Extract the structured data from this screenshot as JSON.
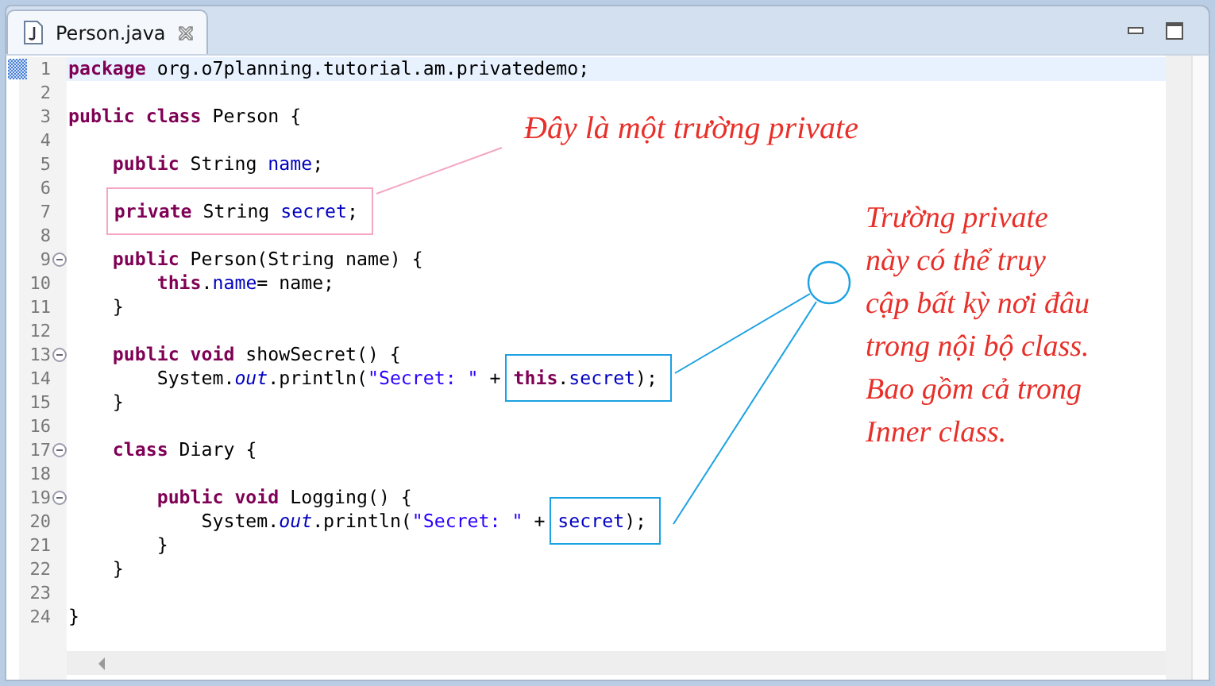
{
  "tab": {
    "title": "Person.java",
    "selected": true
  },
  "lines": [
    {
      "number": "1",
      "current": true,
      "foldable": false,
      "tokens": [
        {
          "kind": "keyword",
          "text": "package"
        },
        {
          "kind": "plain",
          "text": " org.o7planning.tutorial.am.privatedemo;"
        }
      ]
    },
    {
      "number": "2",
      "current": false,
      "foldable": false
    },
    {
      "number": "3",
      "current": false,
      "foldable": false,
      "tokens": [
        {
          "kind": "keyword",
          "text": "public"
        },
        {
          "kind": "keyword",
          "text": " class"
        },
        {
          "kind": "plain",
          "text": " Person {"
        }
      ]
    },
    {
      "number": "4",
      "current": false,
      "foldable": false
    },
    {
      "number": "5",
      "current": false,
      "foldable": false,
      "tokens": [
        {
          "kind": "keyword",
          "text": "    public"
        },
        {
          "kind": "plain",
          "text": " String "
        },
        {
          "kind": "field",
          "text": "name"
        },
        {
          "kind": "plain",
          "text": ";"
        }
      ]
    },
    {
      "number": "6",
      "current": false,
      "foldable": false
    },
    {
      "number": "7",
      "current": false,
      "foldable": false,
      "tokens": [
        {
          "kind": "box",
          "color": "#f4a6c4",
          "tokens": [
            {
              "kind": "keyword",
              "text": "    private"
            },
            {
              "kind": "plain",
              "text": " String "
            },
            {
              "kind": "field",
              "text": "secret"
            },
            {
              "kind": "plain",
              "text": ";"
            }
          ]
        }
      ]
    },
    {
      "number": "8",
      "current": false,
      "foldable": false
    },
    {
      "number": "9",
      "current": false,
      "foldable": true,
      "tokens": [
        {
          "kind": "keyword",
          "text": "    public"
        },
        {
          "kind": "plain",
          "text": " Person(String name) {"
        }
      ]
    },
    {
      "number": "10",
      "current": false,
      "foldable": false,
      "tokens": [
        {
          "kind": "keyword",
          "text": "        this"
        },
        {
          "kind": "plain",
          "text": "."
        },
        {
          "kind": "field",
          "text": "name"
        },
        {
          "kind": "plain",
          "text": "= name;"
        }
      ]
    },
    {
      "number": "11",
      "current": false,
      "foldable": false,
      "tokens": [
        {
          "kind": "plain",
          "text": "    }"
        }
      ]
    },
    {
      "number": "12",
      "current": false,
      "foldable": false
    },
    {
      "number": "13",
      "current": false,
      "foldable": true,
      "tokens": [
        {
          "kind": "keyword",
          "text": "    public void"
        },
        {
          "kind": "plain",
          "text": " showSecret() {"
        }
      ]
    },
    {
      "number": "14",
      "current": false,
      "foldable": false,
      "tokens": [
        {
          "kind": "plain",
          "text": "        System."
        },
        {
          "kind": "static",
          "text": "out"
        },
        {
          "kind": "plain",
          "text": ".println("
        },
        {
          "kind": "string",
          "text": "\"Secret: \""
        },
        {
          "kind": "plain",
          "text": " + "
        },
        {
          "kind": "box",
          "color": "#1ba1e2",
          "tokens": [
            {
              "kind": "keyword",
              "text": "this"
            },
            {
              "kind": "plain",
              "text": "."
            },
            {
              "kind": "field",
              "text": "secret"
            },
            {
              "kind": "plain",
              "text": ");"
            }
          ]
        }
      ]
    },
    {
      "number": "15",
      "current": false,
      "foldable": false,
      "tokens": [
        {
          "kind": "plain",
          "text": "    }"
        }
      ]
    },
    {
      "number": "16",
      "current": false,
      "foldable": false
    },
    {
      "number": "17",
      "current": false,
      "foldable": true,
      "tokens": [
        {
          "kind": "keyword",
          "text": "    class"
        },
        {
          "kind": "plain",
          "text": " Diary {"
        }
      ]
    },
    {
      "number": "18",
      "current": false,
      "foldable": false
    },
    {
      "number": "19",
      "current": false,
      "foldable": true,
      "tokens": [
        {
          "kind": "keyword",
          "text": "        public void"
        },
        {
          "kind": "plain",
          "text": " Logging() {"
        }
      ]
    },
    {
      "number": "20",
      "current": false,
      "foldable": false,
      "tokens": [
        {
          "kind": "plain",
          "text": "            System."
        },
        {
          "kind": "static",
          "text": "out"
        },
        {
          "kind": "plain",
          "text": ".println("
        },
        {
          "kind": "string",
          "text": "\"Secret: \""
        },
        {
          "kind": "plain",
          "text": " + "
        },
        {
          "kind": "box",
          "color": "#1ba1e2",
          "tokens": [
            {
              "kind": "field",
              "text": "secret"
            },
            {
              "kind": "plain",
              "text": ");"
            }
          ]
        }
      ]
    },
    {
      "number": "21",
      "current": false,
      "foldable": false,
      "tokens": [
        {
          "kind": "plain",
          "text": "        }"
        }
      ]
    },
    {
      "number": "22",
      "current": false,
      "foldable": false,
      "tokens": [
        {
          "kind": "plain",
          "text": "    }"
        }
      ]
    },
    {
      "number": "23",
      "current": false,
      "foldable": false
    },
    {
      "number": "24",
      "current": false,
      "foldable": false,
      "tokens": [
        {
          "kind": "plain",
          "text": "}"
        }
      ]
    }
  ],
  "annotations": [
    {
      "kind": "short",
      "color": "#e8302a",
      "lines": [
        "Đây là một trường private"
      ]
    },
    {
      "kind": "long",
      "color": "#e8302a",
      "lines": [
        "Trường private",
        "này có thể truy",
        "cập bất kỳ nơi đâu",
        "trong nội bộ class.",
        "Bao gồm cả trong",
        "Inner class."
      ]
    }
  ]
}
